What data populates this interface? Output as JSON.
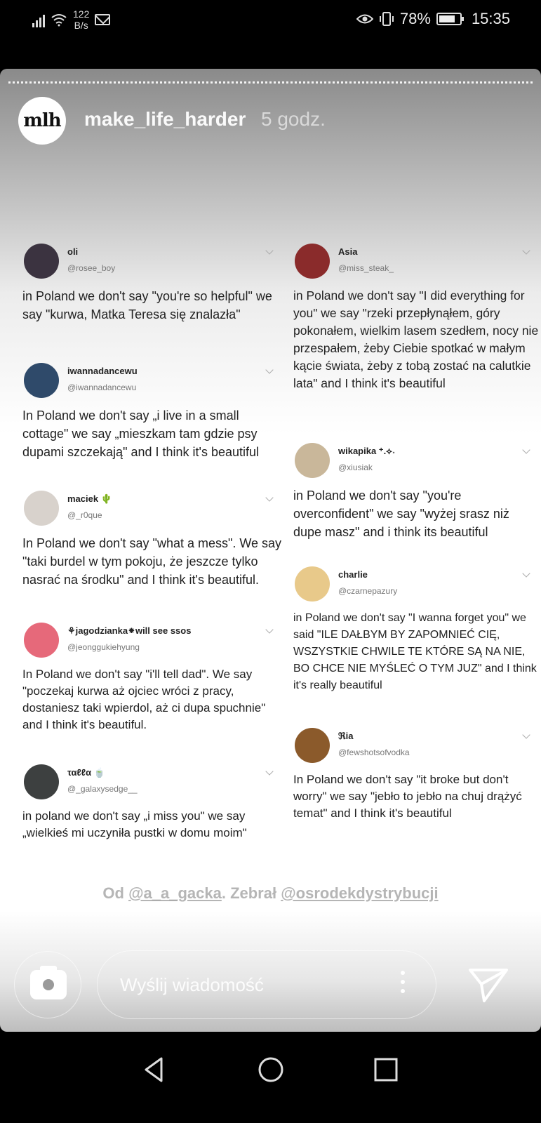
{
  "status_bar": {
    "net_speed_value": "122",
    "net_speed_unit": "B/s",
    "battery": "78%",
    "time": "15:35"
  },
  "story": {
    "avatar_text": "mlh",
    "username": "make_life_harder",
    "time_ago": "5 godz.",
    "credit_prefix": "Od ",
    "credit_author": "@a_a_gacka",
    "credit_middle": ". Zebrał ",
    "credit_collector": "@osrodekdystrybucji"
  },
  "tweets_left": [
    {
      "name": "oli",
      "handle": "@rosee_boy",
      "text": "in Poland we don't say \"you're so helpful\" we say \"kurwa, Matka Teresa się znalazła\""
    },
    {
      "name": "iwannadancewu",
      "handle": "@iwannadancewu",
      "text": "In Poland we don't say „i live in a small cottage\" we say „mieszkam tam gdzie psy dupami szczekają\" and I think it's beautiful"
    },
    {
      "name": "maciek 🌵",
      "handle": "@_r0que",
      "text": "In Poland we don't say \"what a mess\". We say \"taki burdel w tym pokoju, że jeszcze tylko nasrać na środku\" and I think it's beautiful."
    },
    {
      "name": "⚘jagodzianka⁕will see ssos",
      "handle": "@jeonggukiehyung",
      "text": "In Poland we don't say \"i'll tell dad\". We say \"poczekaj kurwa aż ojciec wróci z pracy, dostaniesz taki wpierdol, aż ci dupa spuchnie\" and I think it's beautiful."
    },
    {
      "name": "ταℓℓα 🍵",
      "handle": "@_galaxysedge__",
      "text": "in poland we don't say „i miss you\" we say „wielkieś mi uczyniła pustki w domu moim\""
    }
  ],
  "tweets_right": [
    {
      "name": "Asia",
      "handle": "@miss_steak_",
      "text": "in Poland we don't say \"I did everything for you\" we say \"rzeki przepłynąłem, góry pokonałem, wielkim lasem szedłem, nocy nie przespałem, żeby Ciebie spotkać w małym kącie świata, żeby z tobą zostać na calutkie lata\" and I think it's beautiful"
    },
    {
      "name": "wikapika ⁺.⟡˖",
      "handle": "@xiusiak",
      "text": "in Poland we don't say \"you're overconfident\" we say \"wyżej srasz niż dupe masz\" and i think its beautiful"
    },
    {
      "name": "charlie",
      "handle": "@czarnepazury",
      "text": "in Poland we don't say \"I wanna forget you\" we said \"ILE DAŁBYM BY ZAPOMNIEĆ CIĘ, WSZYSTKIE CHWILE TE KTÓRE SĄ NA NIE, BO CHCE NIE MYŚLEĆ O TYM JUZ\" and I think it's really beautiful"
    },
    {
      "name": "ℜia",
      "handle": "@fewshotsofvodka",
      "text": "In Poland we don't say \"it broke but don't worry\" we say \"jebło to jebło na chuj drążyć temat\" and I think it's beautiful"
    }
  ],
  "reply_bar": {
    "placeholder": "Wyślij wiadomość"
  },
  "colors": {
    "avatar_oli": "#3b3340",
    "avatar_iwanna": "#2f4a6a",
    "avatar_maciek": "#d8d2cc",
    "avatar_jagodzianka": "#e6697a",
    "avatar_talla": "#3d4040",
    "avatar_asia": "#8a2b2b",
    "avatar_wikapika": "#c9b79a",
    "avatar_charlie": "#e8c98a",
    "avatar_ria": "#8b5a2b"
  }
}
